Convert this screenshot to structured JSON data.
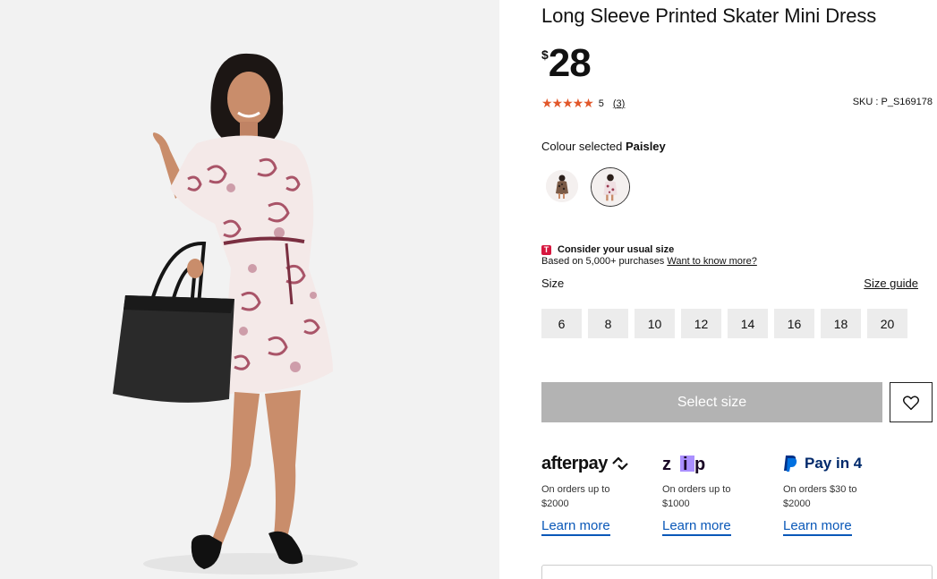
{
  "product": {
    "title": "Long Sleeve Printed Skater Mini Dress",
    "currency": "$",
    "price": "28",
    "rating_stars": "★★★★★",
    "rating_value": "5",
    "review_count": "(3)",
    "sku": "SKU : P_S169178"
  },
  "colour": {
    "label": "Colour selected",
    "selected": "Paisley"
  },
  "fit_advice": {
    "badge": "T",
    "heading": "Consider your usual size",
    "text": "Based on 5,000+ purchases",
    "link": "Want to know more?"
  },
  "size": {
    "label": "Size",
    "guide": "Size guide",
    "options": [
      "6",
      "8",
      "10",
      "12",
      "14",
      "16",
      "18",
      "20"
    ]
  },
  "cta": {
    "label": "Select size"
  },
  "payments": {
    "afterpay": {
      "logo": "afterpay",
      "desc_line1": "On orders up to",
      "desc_line2": "$2000",
      "link": "Learn more"
    },
    "zip": {
      "logo": "zip",
      "desc_line1": "On orders up to",
      "desc_line2": "$1000",
      "link": "Learn more"
    },
    "paypal": {
      "logo": "Pay in 4",
      "desc_line1": "On orders $30 to",
      "desc_line2": "$2000",
      "link": "Learn more"
    }
  },
  "colors": {
    "star": "#e2572a",
    "link_blue": "#0a58b8",
    "cta_disabled": "#b3b3b3",
    "badge_red": "#d6163e"
  }
}
